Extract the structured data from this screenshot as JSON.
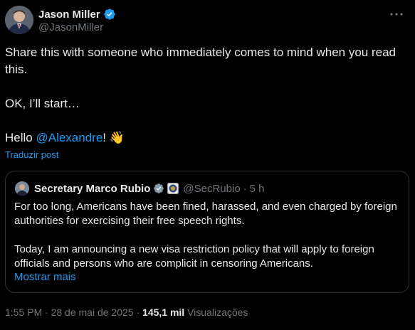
{
  "author": {
    "name": "Jason Miller",
    "handle": "@JasonMiller"
  },
  "tweet": {
    "line1": "Share this with someone who immediately comes to mind when you read this.",
    "line2": "OK, I’ll start…",
    "hello_prefix": "Hello ",
    "mention": "@Alexandre",
    "hello_suffix": "! 👋",
    "translate_label": "Traduzir post"
  },
  "quote": {
    "name": "Secretary Marco Rubio",
    "handle": "@SecRubio",
    "dot": "·",
    "time": "5 h",
    "para1": "For too long, Americans have been fined, harassed, and even charged by foreign authorities for exercising their free speech rights.",
    "para2": "Today, I am announcing a new visa restriction policy that will apply to foreign officials and persons who are complicit in censoring Americans.",
    "show_more": "Mostrar mais"
  },
  "meta": {
    "time": "1:55 PM",
    "sep1": "·",
    "date": "28 de mai de 2025",
    "sep2": "·",
    "views_count": "145,1 mil",
    "views_label": "Visualizações"
  },
  "colors": {
    "background": "#000000",
    "text": "#e7e9ea",
    "muted": "#71767b",
    "link": "#1d9bf0",
    "verified": "#1d9bf0",
    "border": "#2f3336"
  },
  "icons": {
    "verified": "verified-badge-icon",
    "more": "more-options-icon",
    "gov": "government-seal-icon"
  }
}
